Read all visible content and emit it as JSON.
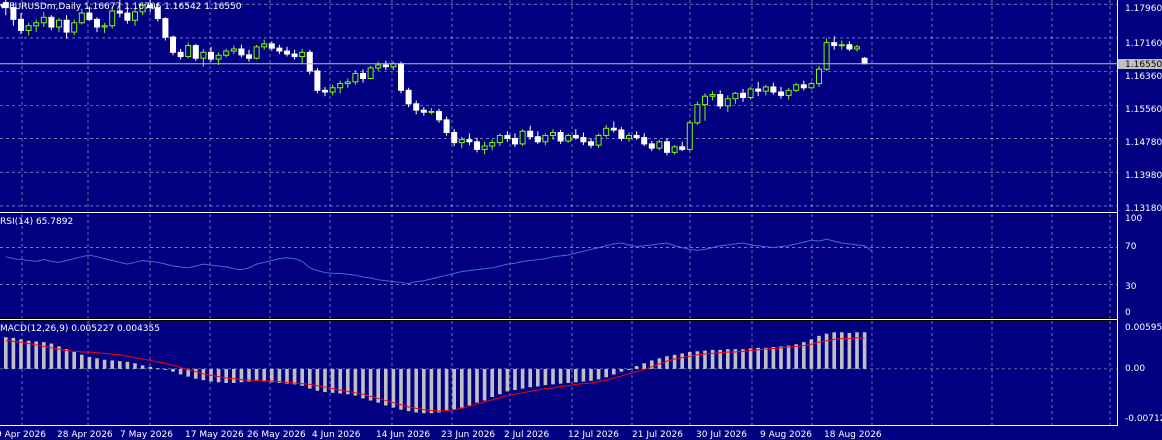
{
  "header": {
    "symbol_line": "EURUSDm,Daily  1.16677 1.16706 1.16542 1.16550",
    "current_price": "1.16550"
  },
  "colors": {
    "background": "#000080",
    "grid": "#ffffff",
    "bull_candle": "#7CFC00",
    "bear_candle": "#ffffff",
    "rsi_line": "#4169E1",
    "macd_hist": "#C0C0C0",
    "macd_signal": "#FF0000",
    "bid_line": "#C0C0C0"
  },
  "price_axis": [
    "1.17960",
    "1.17160",
    "1.16550",
    "1.16360",
    "1.15560",
    "1.14780",
    "1.13980",
    "1.13180"
  ],
  "rsi": {
    "label": "RSI(14) 65.7892",
    "axis": [
      "100",
      "70",
      "30",
      "0"
    ]
  },
  "macd": {
    "label": "MACD(12,26,9) 0.005227 0.004355",
    "axis": [
      "0.00595",
      "0.00",
      "-0.00712"
    ]
  },
  "time_axis": [
    "9 Apr 2026",
    "28 Apr 2026",
    "7 May 2026",
    "17 May 2026",
    "26 May 2026",
    "4 Jun 2026",
    "14 Jun 2026",
    "23 Jun 2026",
    "2 Jul 2026",
    "12 Jul 2026",
    "21 Jul 2026",
    "30 Jul 2026",
    "9 Aug 2026",
    "18 Aug 2026"
  ],
  "chart_data": {
    "type": "candlestick",
    "price_range": [
      1.1306,
      1.1806
    ],
    "candles": [
      [
        1.18,
        1.1806,
        1.177,
        1.1788
      ],
      [
        1.1788,
        1.1798,
        1.1745,
        1.176
      ],
      [
        1.176,
        1.1775,
        1.1725,
        1.1734
      ],
      [
        1.1734,
        1.1752,
        1.1722,
        1.1745
      ],
      [
        1.1745,
        1.176,
        1.173,
        1.1752
      ],
      [
        1.1752,
        1.1778,
        1.1742,
        1.1765
      ],
      [
        1.1765,
        1.177,
        1.1735,
        1.1742
      ],
      [
        1.1742,
        1.1763,
        1.173,
        1.1758
      ],
      [
        1.1758,
        1.177,
        1.1714,
        1.173
      ],
      [
        1.173,
        1.176,
        1.1722,
        1.1752
      ],
      [
        1.1752,
        1.1785,
        1.1748,
        1.1775
      ],
      [
        1.1775,
        1.179,
        1.1756,
        1.176
      ],
      [
        1.176,
        1.1765,
        1.173,
        1.1742
      ],
      [
        1.1742,
        1.1752,
        1.1728,
        1.1745
      ],
      [
        1.1745,
        1.179,
        1.1738,
        1.178
      ],
      [
        1.178,
        1.1806,
        1.1765,
        1.1775
      ],
      [
        1.1775,
        1.179,
        1.175,
        1.1758
      ],
      [
        1.1758,
        1.1785,
        1.1745,
        1.1778
      ],
      [
        1.1778,
        1.18,
        1.177,
        1.1794
      ],
      [
        1.1794,
        1.1806,
        1.1778,
        1.1788
      ],
      [
        1.1788,
        1.18,
        1.1755,
        1.1762
      ],
      [
        1.1762,
        1.1765,
        1.171,
        1.1718
      ],
      [
        1.1718,
        1.1722,
        1.1675,
        1.1682
      ],
      [
        1.1682,
        1.169,
        1.1665,
        1.1672
      ],
      [
        1.1672,
        1.1705,
        1.1668,
        1.1698
      ],
      [
        1.1698,
        1.1702,
        1.1662,
        1.1668
      ],
      [
        1.1668,
        1.169,
        1.1648,
        1.1682
      ],
      [
        1.1682,
        1.1695,
        1.166,
        1.1666
      ],
      [
        1.1666,
        1.1682,
        1.1652,
        1.1675
      ],
      [
        1.1675,
        1.169,
        1.167,
        1.1685
      ],
      [
        1.1685,
        1.1698,
        1.1678,
        1.169
      ],
      [
        1.169,
        1.17,
        1.167,
        1.1676
      ],
      [
        1.1676,
        1.1688,
        1.166,
        1.1668
      ],
      [
        1.1668,
        1.17,
        1.1665,
        1.1695
      ],
      [
        1.1695,
        1.1712,
        1.1688,
        1.1702
      ],
      [
        1.1702,
        1.1708,
        1.1686,
        1.1692
      ],
      [
        1.1692,
        1.17,
        1.1678,
        1.1685
      ],
      [
        1.1685,
        1.1695,
        1.1672,
        1.1678
      ],
      [
        1.1678,
        1.1688,
        1.1665,
        1.1672
      ],
      [
        1.1672,
        1.169,
        1.1655,
        1.1682
      ],
      [
        1.1682,
        1.1688,
        1.163,
        1.1638
      ],
      [
        1.1638,
        1.1645,
        1.1585,
        1.1592
      ],
      [
        1.1592,
        1.16,
        1.1578,
        1.1588
      ],
      [
        1.1588,
        1.1605,
        1.158,
        1.1598
      ],
      [
        1.1598,
        1.1615,
        1.1585,
        1.1608
      ],
      [
        1.1608,
        1.162,
        1.1598,
        1.1612
      ],
      [
        1.1612,
        1.164,
        1.1605,
        1.1632
      ],
      [
        1.1632,
        1.1642,
        1.161,
        1.162
      ],
      [
        1.162,
        1.165,
        1.1618,
        1.1645
      ],
      [
        1.1645,
        1.166,
        1.1638,
        1.1652
      ],
      [
        1.1652,
        1.1662,
        1.164,
        1.1648
      ],
      [
        1.1648,
        1.166,
        1.164,
        1.1655
      ],
      [
        1.1655,
        1.166,
        1.1585,
        1.1592
      ],
      [
        1.1592,
        1.1598,
        1.1552,
        1.156
      ],
      [
        1.156,
        1.1568,
        1.1535,
        1.1545
      ],
      [
        1.1545,
        1.1552,
        1.1532,
        1.154
      ],
      [
        1.154,
        1.155,
        1.1535,
        1.1542
      ],
      [
        1.1542,
        1.1548,
        1.1515,
        1.1522
      ],
      [
        1.1522,
        1.153,
        1.1485,
        1.1492
      ],
      [
        1.1492,
        1.15,
        1.146,
        1.1468
      ],
      [
        1.1468,
        1.1482,
        1.1455,
        1.1475
      ],
      [
        1.1475,
        1.149,
        1.1462,
        1.147
      ],
      [
        1.147,
        1.148,
        1.1445,
        1.1452
      ],
      [
        1.1452,
        1.147,
        1.144,
        1.146
      ],
      [
        1.146,
        1.1475,
        1.145,
        1.1468
      ],
      [
        1.1468,
        1.149,
        1.146,
        1.1485
      ],
      [
        1.1485,
        1.1495,
        1.147,
        1.1478
      ],
      [
        1.1478,
        1.149,
        1.1458,
        1.1465
      ],
      [
        1.1465,
        1.15,
        1.146,
        1.1495
      ],
      [
        1.1495,
        1.1508,
        1.1475,
        1.1482
      ],
      [
        1.1482,
        1.1495,
        1.1465,
        1.147
      ],
      [
        1.147,
        1.149,
        1.1462,
        1.1485
      ],
      [
        1.1485,
        1.15,
        1.1475,
        1.1492
      ],
      [
        1.1492,
        1.1498,
        1.1465,
        1.1472
      ],
      [
        1.1472,
        1.149,
        1.1468,
        1.1485
      ],
      [
        1.1485,
        1.15,
        1.1475,
        1.148
      ],
      [
        1.148,
        1.1492,
        1.1462,
        1.147
      ],
      [
        1.147,
        1.1478,
        1.1455,
        1.1462
      ],
      [
        1.1462,
        1.149,
        1.1455,
        1.1485
      ],
      [
        1.1485,
        1.151,
        1.148,
        1.1502
      ],
      [
        1.1502,
        1.1518,
        1.1492,
        1.1498
      ],
      [
        1.1498,
        1.1505,
        1.1472,
        1.1478
      ],
      [
        1.1478,
        1.1492,
        1.147,
        1.1485
      ],
      [
        1.1485,
        1.1495,
        1.1475,
        1.148
      ],
      [
        1.148,
        1.149,
        1.146,
        1.1465
      ],
      [
        1.1465,
        1.1472,
        1.1448,
        1.1455
      ],
      [
        1.1455,
        1.1475,
        1.145,
        1.147
      ],
      [
        1.147,
        1.1478,
        1.1438,
        1.1445
      ],
      [
        1.1445,
        1.1462,
        1.144,
        1.1458
      ],
      [
        1.1458,
        1.147,
        1.1448,
        1.1452
      ],
      [
        1.1452,
        1.152,
        1.1448,
        1.1515
      ],
      [
        1.1515,
        1.1565,
        1.151,
        1.1558
      ],
      [
        1.1558,
        1.1585,
        1.152,
        1.1578
      ],
      [
        1.1578,
        1.159,
        1.1568,
        1.1582
      ],
      [
        1.1582,
        1.1592,
        1.1548,
        1.1555
      ],
      [
        1.1555,
        1.158,
        1.154,
        1.1572
      ],
      [
        1.1572,
        1.1588,
        1.156,
        1.1585
      ],
      [
        1.1585,
        1.1595,
        1.1565,
        1.1575
      ],
      [
        1.1575,
        1.16,
        1.157,
        1.1595
      ],
      [
        1.1595,
        1.1612,
        1.1578,
        1.159
      ],
      [
        1.159,
        1.1605,
        1.158,
        1.16
      ],
      [
        1.16,
        1.161,
        1.1582,
        1.1588
      ],
      [
        1.1588,
        1.16,
        1.1572,
        1.158
      ],
      [
        1.158,
        1.1598,
        1.157,
        1.1592
      ],
      [
        1.1592,
        1.161,
        1.1588,
        1.1605
      ],
      [
        1.1605,
        1.1615,
        1.1592,
        1.1598
      ],
      [
        1.1598,
        1.1612,
        1.1595,
        1.1608
      ],
      [
        1.1608,
        1.165,
        1.16,
        1.1642
      ],
      [
        1.1642,
        1.1715,
        1.1638,
        1.1705
      ],
      [
        1.1705,
        1.172,
        1.1688,
        1.1698
      ],
      [
        1.1698,
        1.171,
        1.1688,
        1.17
      ],
      [
        1.17,
        1.1708,
        1.1685,
        1.169
      ],
      [
        1.169,
        1.17,
        1.1684,
        1.1695
      ],
      [
        1.1668,
        1.1671,
        1.1654,
        1.1655
      ]
    ],
    "rsi_range": [
      0,
      100
    ],
    "rsi_values": [
      60,
      58,
      57,
      56,
      55,
      57,
      55,
      54,
      56,
      58,
      60,
      62,
      60,
      58,
      56,
      54,
      52,
      54,
      56,
      55,
      54,
      52,
      50,
      49,
      48,
      50,
      52,
      51,
      50,
      49,
      47,
      46,
      48,
      52,
      54,
      56,
      58,
      59,
      58,
      55,
      48,
      45,
      43,
      42,
      42,
      41,
      40,
      38,
      37,
      35,
      34,
      33,
      32,
      31,
      33,
      34,
      36,
      38,
      40,
      42,
      44,
      45,
      46,
      47,
      48,
      50,
      52,
      53,
      55,
      56,
      57,
      58,
      60,
      61,
      62,
      64,
      66,
      68,
      70,
      72,
      74,
      75,
      73,
      71,
      72,
      73,
      74,
      75,
      72,
      70,
      68,
      67,
      68,
      70,
      72,
      73,
      74,
      75,
      73,
      72,
      71,
      70,
      71,
      72,
      74,
      76,
      78,
      77,
      79,
      77,
      75,
      74,
      73,
      72,
      66
    ],
    "macd_range": [
      -0.00712,
      0.00595
    ],
    "macd_hist": [
      0.0045,
      0.0044,
      0.0042,
      0.004,
      0.0039,
      0.0038,
      0.0036,
      0.0032,
      0.0028,
      0.0024,
      0.002,
      0.0017,
      0.0015,
      0.0013,
      0.0012,
      0.0011,
      0.001,
      0.0008,
      0.0005,
      0.0003,
      0.0001,
      -0.0001,
      -0.0004,
      -0.0008,
      -0.0011,
      -0.0014,
      -0.0016,
      -0.0018,
      -0.0019,
      -0.002,
      -0.002,
      -0.0019,
      -0.0018,
      -0.0017,
      -0.0018,
      -0.0019,
      -0.002,
      -0.0021,
      -0.0022,
      -0.0024,
      -0.0028,
      -0.0031,
      -0.0033,
      -0.0034,
      -0.0035,
      -0.0036,
      -0.0038,
      -0.0042,
      -0.0045,
      -0.0048,
      -0.0052,
      -0.0055,
      -0.0058,
      -0.006,
      -0.0062,
      -0.0063,
      -0.0063,
      -0.0062,
      -0.006,
      -0.0058,
      -0.0055,
      -0.0052,
      -0.0048,
      -0.0045,
      -0.004,
      -0.0036,
      -0.0032,
      -0.003,
      -0.0028,
      -0.0026,
      -0.0025,
      -0.0023,
      -0.0022,
      -0.0021,
      -0.002,
      -0.0019,
      -0.0018,
      -0.0017,
      -0.0015,
      -0.0012,
      -0.0008,
      -0.0004,
      0.0,
      0.0004,
      0.0008,
      0.0012,
      0.0015,
      0.0018,
      0.002,
      0.0022,
      0.0024,
      0.0025,
      0.0026,
      0.0027,
      0.0027,
      0.0028,
      0.0028,
      0.0028,
      0.0029,
      0.003,
      0.003,
      0.0031,
      0.0032,
      0.0033,
      0.0035,
      0.0038,
      0.0042,
      0.0047,
      0.005,
      0.0052,
      0.0052,
      0.0051,
      0.0052,
      0.0052
    ],
    "macd_signal": [
      0.004,
      0.0039,
      0.0038,
      0.0036,
      0.0034,
      0.0032,
      0.003,
      0.0028,
      0.0026,
      0.0025,
      0.0024,
      0.0024,
      0.0023,
      0.0022,
      0.0021,
      0.002,
      0.0018,
      0.0016,
      0.0014,
      0.0012,
      0.001,
      0.0008,
      0.0005,
      0.0002,
      -0.0001,
      -0.0004,
      -0.0007,
      -0.0009,
      -0.0011,
      -0.0013,
      -0.0014,
      -0.0015,
      -0.0016,
      -0.0016,
      -0.0017,
      -0.0017,
      -0.0018,
      -0.0019,
      -0.002,
      -0.0021,
      -0.0022,
      -0.0024,
      -0.0026,
      -0.0028,
      -0.003,
      -0.0032,
      -0.0034,
      -0.0036,
      -0.0039,
      -0.0042,
      -0.0045,
      -0.0048,
      -0.0051,
      -0.0054,
      -0.0056,
      -0.0058,
      -0.0059,
      -0.006,
      -0.0059,
      -0.0058,
      -0.0056,
      -0.0053,
      -0.005,
      -0.0047,
      -0.0044,
      -0.0041,
      -0.0038,
      -0.0036,
      -0.0034,
      -0.0032,
      -0.003,
      -0.0028,
      -0.0027,
      -0.0025,
      -0.0024,
      -0.0022,
      -0.0021,
      -0.002,
      -0.0018,
      -0.0016,
      -0.0013,
      -0.001,
      -0.0007,
      -0.0004,
      -0.0001,
      0.0003,
      0.0007,
      0.0011,
      0.0014,
      0.0016,
      0.0018,
      0.002,
      0.0021,
      0.0022,
      0.0023,
      0.0024,
      0.0024,
      0.0025,
      0.0026,
      0.0027,
      0.0028,
      0.0029,
      0.003,
      0.0031,
      0.0032,
      0.0033,
      0.0035,
      0.0038,
      0.004,
      0.0042,
      0.0043,
      0.0043,
      0.0044,
      0.0044
    ]
  }
}
